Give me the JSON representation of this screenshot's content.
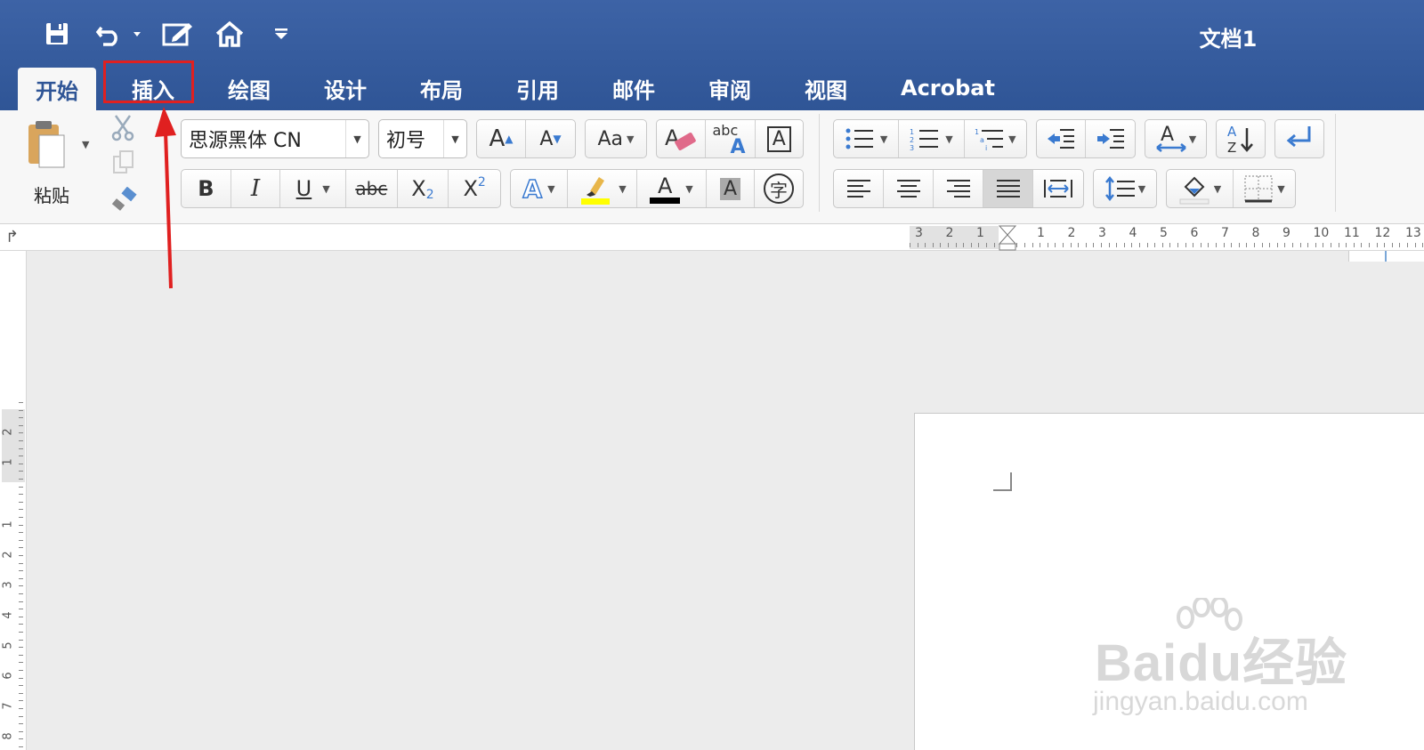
{
  "title_bar": {
    "doc_title": "文档1",
    "tabs": [
      "开始",
      "插入",
      "绘图",
      "设计",
      "布局",
      "引用",
      "邮件",
      "审阅",
      "视图",
      "Acrobat"
    ]
  },
  "ribbon": {
    "paste_label": "粘贴",
    "font_name": "思源黑体 CN",
    "font_size": "初号",
    "bold": "B",
    "italic": "I",
    "underline": "U",
    "strike": "abc",
    "grow": "A",
    "shrink": "A",
    "change_case": "Aa",
    "subscript": "X",
    "subscript_mark": "2",
    "superscript": "X",
    "superscript_mark": "2",
    "char_border": "A",
    "font_color": "A",
    "text_effects": "A",
    "char_shading": "A",
    "phonetic": "字",
    "abc_label": "abc",
    "style_preview": "Aa"
  },
  "ruler": {
    "h_left_ticks": [
      "3",
      "2",
      "1"
    ],
    "h_right_ticks": [
      "1",
      "2",
      "3",
      "4",
      "5",
      "6",
      "7",
      "8",
      "9",
      "10",
      "11",
      "12",
      "13"
    ],
    "v_ticks": [
      "2",
      "1",
      "1",
      "2",
      "3",
      "4",
      "5",
      "6",
      "7",
      "8"
    ]
  },
  "watermark": {
    "brand": "Baidu经验",
    "url": "jingyan.baidu.com"
  },
  "colors": {
    "accent": "#2f5596",
    "highlight_box": "#e02020",
    "arrow": "#e02020"
  }
}
